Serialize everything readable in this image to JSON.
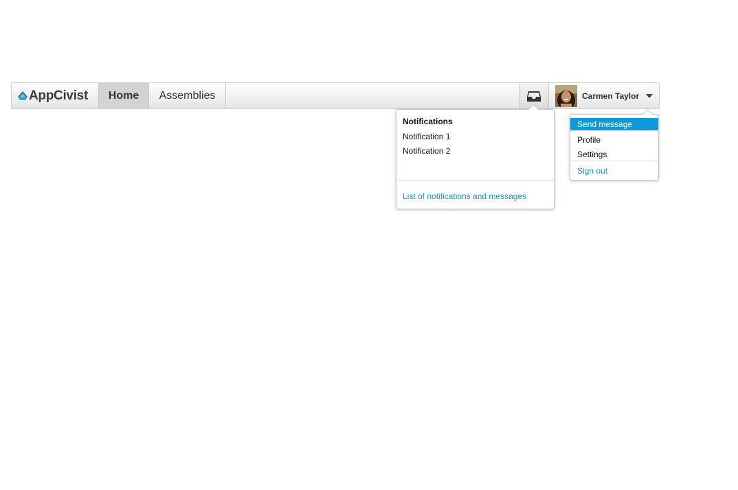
{
  "navbar": {
    "brand": "AppCivist",
    "items": [
      {
        "label": "Home",
        "active": true
      },
      {
        "label": "Assemblies",
        "active": false
      }
    ],
    "inbox_icon": "inbox-icon",
    "user": {
      "name": "Carmen Taylor"
    }
  },
  "notifications": {
    "title": "Notifications",
    "items": [
      "Notification 1",
      "Notification 2"
    ],
    "footer_link": "List of notifications and messages"
  },
  "user_menu": {
    "items": [
      {
        "label": "Send message",
        "highlighted": true
      },
      {
        "label": "Profile"
      },
      {
        "label": "Settings"
      },
      {
        "label": "Sign out"
      }
    ]
  },
  "colors": {
    "accent": "#0d9ad9",
    "link": "#1a95cc",
    "active_nav": "#d3d3d3"
  }
}
